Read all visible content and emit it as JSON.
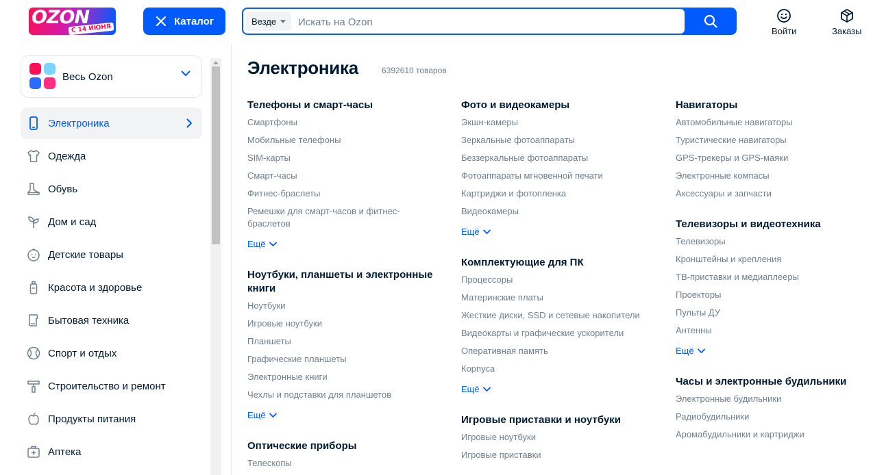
{
  "header": {
    "logo": {
      "word": "OZON",
      "tag": "С 14 ИЮНЯ"
    },
    "catalog_label": "Каталог",
    "search": {
      "scope": "Везде",
      "placeholder": "Искать на Ozon"
    },
    "actions": [
      {
        "label": "Войти",
        "icon": "smile-icon"
      },
      {
        "label": "Заказы",
        "icon": "box-icon"
      }
    ],
    "accent_color": "#005bff"
  },
  "sidebar": {
    "all_label": "Весь Ozon",
    "items": [
      {
        "label": "Электроника",
        "icon": "phone-icon",
        "active": true
      },
      {
        "label": "Одежда",
        "icon": "shirt-icon"
      },
      {
        "label": "Обувь",
        "icon": "shoe-icon"
      },
      {
        "label": "Дом и сад",
        "icon": "sprout-icon"
      },
      {
        "label": "Детские товары",
        "icon": "baby-icon"
      },
      {
        "label": "Красота и здоровье",
        "icon": "bottle-icon"
      },
      {
        "label": "Бытовая техника",
        "icon": "appliance-icon"
      },
      {
        "label": "Спорт и отдых",
        "icon": "ball-icon"
      },
      {
        "label": "Строительство и ремонт",
        "icon": "tools-icon"
      },
      {
        "label": "Продукты питания",
        "icon": "apple-icon"
      },
      {
        "label": "Аптека",
        "icon": "first-aid-icon"
      }
    ]
  },
  "main": {
    "title": "Электроника",
    "count": "6392610 товаров",
    "more_label": "Ещё",
    "columns": [
      [
        {
          "title": "Телефоны и смарт-часы",
          "more": true,
          "links": [
            "Смартфоны",
            "Мобильные телефоны",
            "SIM-карты",
            "Смарт-часы",
            "Фитнес-браслеты",
            "Ремешки для смарт-часов и фитнес-браслетов"
          ]
        },
        {
          "title": "Ноутбуки, планшеты и электронные книги",
          "more": true,
          "links": [
            "Ноутбуки",
            "Игровые ноутбуки",
            "Планшеты",
            "Графические планшеты",
            "Электронные книги",
            "Чехлы и подставки для планшетов"
          ]
        },
        {
          "title": "Оптические приборы",
          "more": false,
          "links": [
            "Телескопы"
          ]
        }
      ],
      [
        {
          "title": "Фото и видеокамеры",
          "more": true,
          "links": [
            "Экшн-камеры",
            "Зеркальные фотоаппараты",
            "Беззеркальные фотоаппараты",
            "Фотоаппараты мгновенной печати",
            "Картриджи и фотопленка",
            "Видеокамеры"
          ]
        },
        {
          "title": "Комплектующие для ПК",
          "more": true,
          "links": [
            "Процессоры",
            "Материнские платы",
            "Жесткие диски, SSD и сетевые накопители",
            "Видеокарты и графические ускорители",
            "Оперативная память",
            "Корпуса"
          ]
        },
        {
          "title": "Игровые приставки и ноутбуки",
          "more": false,
          "links": [
            "Игровые ноутбуки",
            "Игровые приставки"
          ]
        }
      ],
      [
        {
          "title": "Навигаторы",
          "more": false,
          "links": [
            "Автомобильные навигаторы",
            "Туристические навигаторы",
            "GPS-трекеры и GPS-маяки",
            "Электронные компасы",
            "Аксессуары и запчасти"
          ]
        },
        {
          "title": "Телевизоры и видеотехника",
          "more": true,
          "links": [
            "Телевизоры",
            "Кронштейны и крепления",
            "ТВ-приставки и медиаплееры",
            "Проекторы",
            "Пульты ДУ",
            "Антенны"
          ]
        },
        {
          "title": "Часы и электронные будильники",
          "more": false,
          "links": [
            "Электронные будильники",
            "Радиобудильники",
            "Аромабудильники и картриджи"
          ]
        }
      ]
    ]
  }
}
